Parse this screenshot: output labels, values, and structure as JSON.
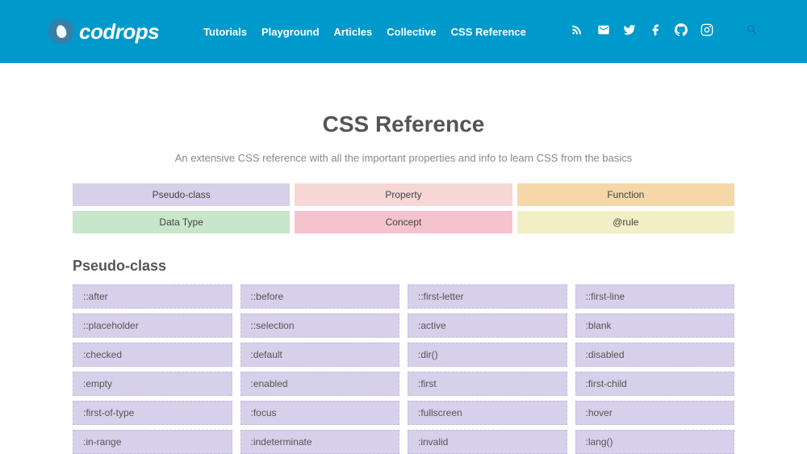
{
  "header": {
    "logo": "codrops",
    "nav": [
      "Tutorials",
      "Playground",
      "Articles",
      "Collective",
      "CSS Reference"
    ]
  },
  "page": {
    "title": "CSS Reference",
    "subtitle": "An extensive CSS reference with all the important properties and info to learn CSS from the basics"
  },
  "categories": [
    {
      "label": "Pseudo-class",
      "class": "cat-pseudo"
    },
    {
      "label": "Property",
      "class": "cat-property"
    },
    {
      "label": "Function",
      "class": "cat-function"
    },
    {
      "label": "Data Type",
      "class": "cat-datatype"
    },
    {
      "label": "Concept",
      "class": "cat-concept"
    },
    {
      "label": "@rule",
      "class": "cat-rule"
    }
  ],
  "section": {
    "title": "Pseudo-class",
    "items": [
      "::after",
      "::before",
      "::first-letter",
      "::first-line",
      "::placeholder",
      "::selection",
      ":active",
      ":blank",
      ":checked",
      ":default",
      ":dir()",
      ":disabled",
      ":empty",
      ":enabled",
      ":first",
      ":first-child",
      ":first-of-type",
      ":focus",
      ":fullscreen",
      ":hover",
      ":in-range",
      ":indeterminate",
      ":invalid",
      ":lang()"
    ]
  }
}
